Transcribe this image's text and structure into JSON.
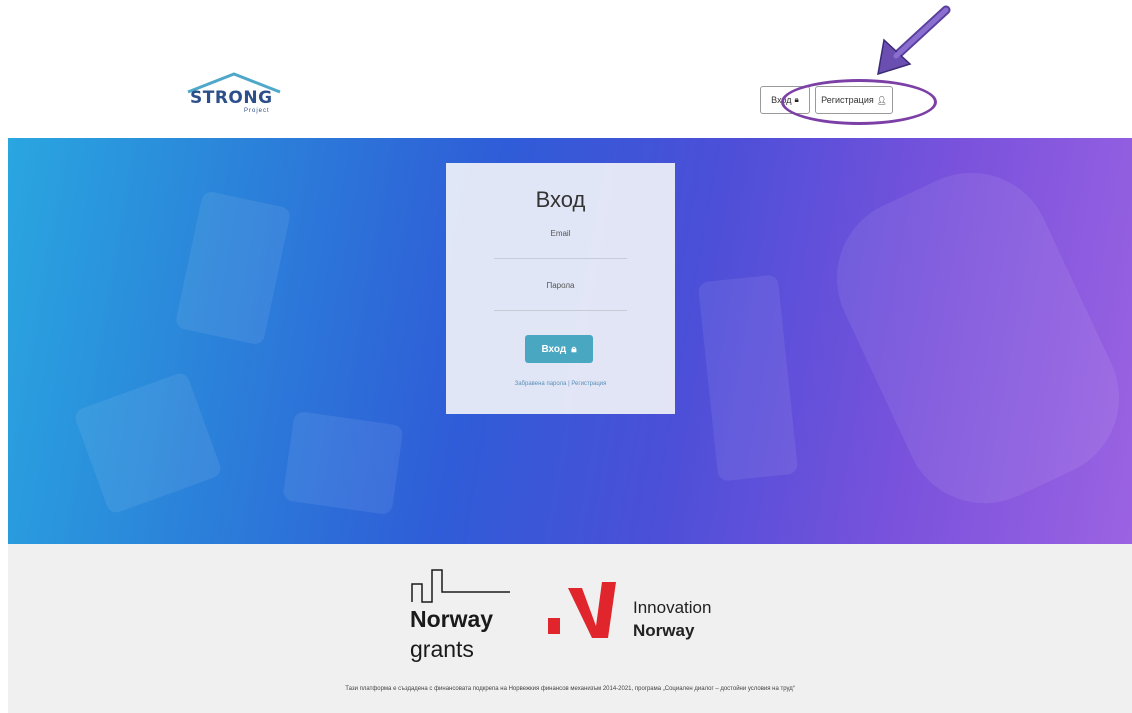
{
  "header": {
    "logo_text": "STRONG",
    "logo_sub": "Project",
    "nav": {
      "login_label": "Вход",
      "register_label": "Регистрация"
    }
  },
  "login_card": {
    "title": "Вход",
    "email_label": "Email",
    "password_label": "Парола",
    "submit_label": "Вход",
    "forgot_password_link": "Забравена парола",
    "register_link": "Регистрация"
  },
  "footer": {
    "norway_grants_line1": "Norway",
    "norway_grants_line2": "grants",
    "innovation_norway_line1": "Innovation",
    "innovation_norway_line2": "Norway",
    "text": "Тази платформа е създадена с финансовата подкрепа на Норвежкия финансов механизъм 2014-2021, програма „Социален диалог – достойни условия на труд“"
  },
  "colors": {
    "accent_button": "#4aa7c2",
    "annotation": "#7b3fa6",
    "logo_blue": "#2c4f8a",
    "innovation_red": "#e0262c"
  },
  "icons": {
    "login_nav": "lock-icon",
    "register_nav": "user-plus-icon",
    "submit": "lock-icon"
  }
}
